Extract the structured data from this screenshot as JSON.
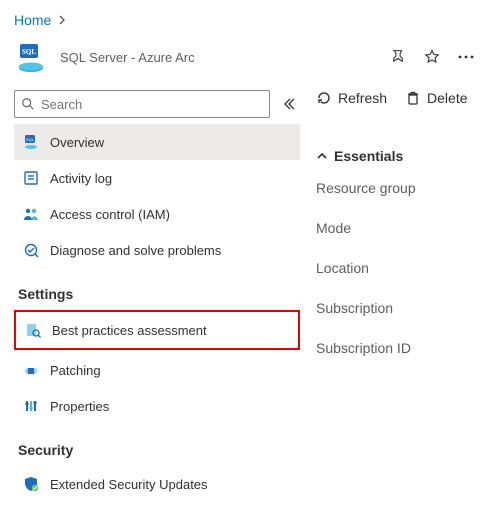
{
  "breadcrumb": {
    "home": "Home"
  },
  "header": {
    "subtitle": "SQL Server - Azure Arc"
  },
  "search": {
    "placeholder": "Search"
  },
  "nav": {
    "overview": "Overview",
    "activity_log": "Activity log",
    "iam": "Access control (IAM)",
    "diagnose": "Diagnose and solve problems",
    "section_settings": "Settings",
    "bpa": "Best practices assessment",
    "patching": "Patching",
    "properties": "Properties",
    "section_security": "Security",
    "esu": "Extended Security Updates"
  },
  "toolbar": {
    "refresh": "Refresh",
    "delete": "Delete"
  },
  "essentials": {
    "title": "Essentials",
    "fields": {
      "resource_group": "Resource group",
      "mode": "Mode",
      "location": "Location",
      "subscription": "Subscription",
      "subscription_id": "Subscription ID"
    }
  }
}
